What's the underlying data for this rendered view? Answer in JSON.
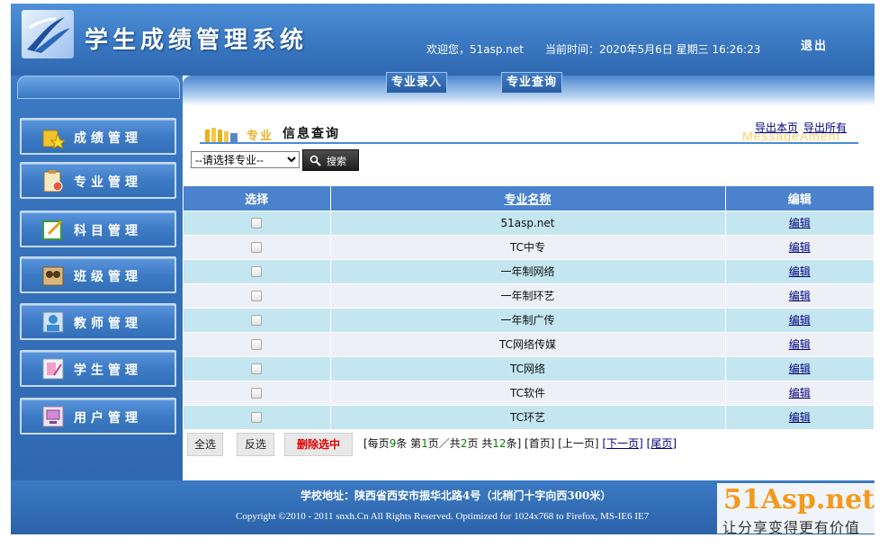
{
  "header": {
    "title": "学生成绩管理系统",
    "welcome": "欢迎您，51asp.net",
    "datetime": "当前时间：2020年5月6日 星期三 16:26:23",
    "logout": "退出"
  },
  "sidebar": {
    "items": [
      {
        "label": "成绩管理",
        "icon": "folder-star-icon"
      },
      {
        "label": "专业管理",
        "icon": "clipboard-icon"
      },
      {
        "label": "科目管理",
        "icon": "notepad-pencil-icon"
      },
      {
        "label": "班级管理",
        "icon": "group-icon"
      },
      {
        "label": "教师管理",
        "icon": "teacher-user-icon"
      },
      {
        "label": "学生管理",
        "icon": "student-icon"
      },
      {
        "label": "用户管理",
        "icon": "user-computer-icon"
      }
    ]
  },
  "tabs": {
    "entry": "专业录入",
    "query": "专业查询"
  },
  "section": {
    "subtitle": "专业",
    "title": "信息查询",
    "english": "MessageAment",
    "export_page": "导出本页",
    "export_all": "导出所有"
  },
  "filter": {
    "select_value": "--请选择专业--",
    "search_label": "搜索"
  },
  "table": {
    "headers": [
      "选择",
      "专业名称",
      "编辑"
    ],
    "edit_label": "编辑",
    "rows": [
      {
        "name": "51asp.net"
      },
      {
        "name": "TC中专"
      },
      {
        "name": "一年制网络"
      },
      {
        "name": "一年制环艺"
      },
      {
        "name": "一年制广传"
      },
      {
        "name": "TC网络传媒"
      },
      {
        "name": "TC网络"
      },
      {
        "name": "TC软件"
      },
      {
        "name": "TC环艺"
      }
    ]
  },
  "controls": {
    "select_all": "全选",
    "invert": "反选",
    "delete_selected": "删除选中"
  },
  "pager": {
    "pre_per": "[每页",
    "per_page": "9",
    "per_unit": "条 第",
    "current": "1",
    "mid": "页／共",
    "total_pages": "2",
    "mid2": "页 共",
    "total_records": "12",
    "post": "条] [首页] [上一页]",
    "next": "[下一页]",
    "last": "[尾页]"
  },
  "footer": {
    "address": "学校地址：陕西省西安市振华北路4号（北稍门十字向西300米）",
    "copyright": "Copyright ©2010 - 2011 snxh.Cn All Rights Reserved. Optimized for 1024x768 to Firefox, MS-IE6 IE7"
  },
  "watermark": {
    "logo": "51Asp.net",
    "slogan": "让分享变得更有价值"
  },
  "colors": {
    "frame_blue": "#3a78c2",
    "table_header": "#4b82cd",
    "row_a": "#c4e6f0",
    "row_b": "#eef0f8",
    "link": "#000080",
    "delete_red": "#e00000",
    "pager_number": "#008000"
  }
}
